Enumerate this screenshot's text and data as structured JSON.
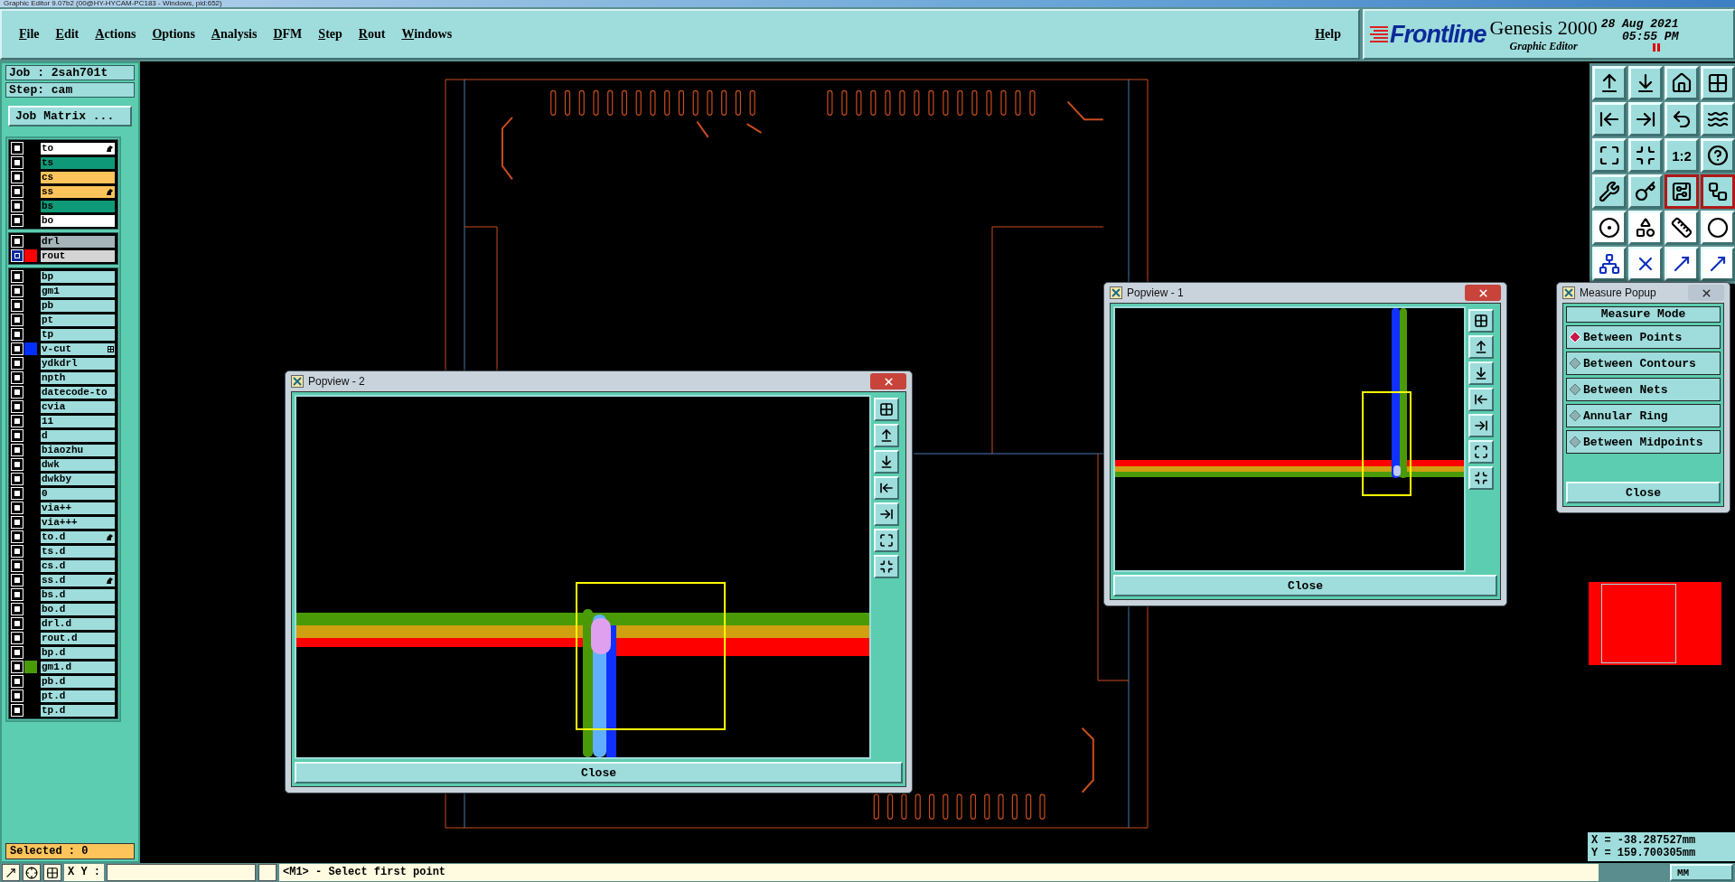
{
  "title_bar": {
    "title": "Graphic Editor 9.07b2 (00@HY-HYCAM-PC183 - Windows, pid:652)"
  },
  "menu": [
    "File",
    "Edit",
    "Actions",
    "Options",
    "Analysis",
    "DFM",
    "Step",
    "Rout",
    "Windows"
  ],
  "help": "Help",
  "brand": {
    "logo": "Frontline",
    "product": "Genesis 2000",
    "subtitle": "Graphic Editor",
    "date": "28 Aug 2021",
    "time": "05:55 PM"
  },
  "job": {
    "job": "Job : 2sah701t",
    "step": "Step: cam",
    "matrix_button": "Job Matrix ..."
  },
  "layer_groups": [
    {
      "layers": [
        {
          "name": "to",
          "color": "#ffffff",
          "selected": false,
          "badge": {
            "kind": "hand"
          }
        },
        {
          "name": "ts",
          "color": "#0e9a78",
          "selected": false
        },
        {
          "name": "cs",
          "color": "#fcc45a",
          "selected": false
        },
        {
          "name": "ss",
          "color": "#fcc45a",
          "selected": false,
          "badge": {
            "kind": "hand"
          }
        },
        {
          "name": "bs",
          "color": "#0e9a78",
          "selected": false
        },
        {
          "name": "bo",
          "color": "#ffffff",
          "selected": false
        }
      ]
    },
    {
      "layers": [
        {
          "name": "drl",
          "color": "#a4b4b8",
          "selected": false
        },
        {
          "name": "rout",
          "color": "#d4d4d4",
          "selected": true,
          "swatch": {
            "color": "#ff0000"
          }
        }
      ]
    },
    {
      "layers": [
        {
          "name": "bp",
          "color": "#9fdcdc",
          "selected": false
        },
        {
          "name": "gm1",
          "color": "#9fdcdc",
          "selected": false
        },
        {
          "name": "pb",
          "color": "#9fdcdc",
          "selected": false
        },
        {
          "name": "pt",
          "color": "#9fdcdc",
          "selected": false
        },
        {
          "name": "tp",
          "color": "#9fdcdc",
          "selected": false
        },
        {
          "name": "v-cut",
          "color": "#9fdcdc",
          "selected": false,
          "swatch": {
            "color": "#0030ff"
          },
          "badge": {
            "kind": "grid"
          }
        },
        {
          "name": "ydkdrl",
          "color": "#9fdcdc",
          "selected": false
        },
        {
          "name": "npth",
          "color": "#9fdcdc",
          "selected": false
        },
        {
          "name": "datecode-to",
          "color": "#9fdcdc",
          "selected": false
        },
        {
          "name": "cvia",
          "color": "#9fdcdc",
          "selected": false
        },
        {
          "name": "11",
          "color": "#9fdcdc",
          "selected": false
        },
        {
          "name": "d",
          "color": "#9fdcdc",
          "selected": false
        },
        {
          "name": "biaozhu",
          "color": "#9fdcdc",
          "selected": false
        },
        {
          "name": "dwk",
          "color": "#9fdcdc",
          "selected": false
        },
        {
          "name": "dwkby",
          "color": "#9fdcdc",
          "selected": false
        },
        {
          "name": "0",
          "color": "#9fdcdc",
          "selected": false
        },
        {
          "name": "via++",
          "color": "#9fdcdc",
          "selected": false
        },
        {
          "name": "via+++",
          "color": "#9fdcdc",
          "selected": false
        },
        {
          "name": "to.d",
          "color": "#9fdcdc",
          "selected": false,
          "badge": {
            "kind": "hand"
          }
        },
        {
          "name": "ts.d",
          "color": "#9fdcdc",
          "selected": false
        },
        {
          "name": "cs.d",
          "color": "#9fdcdc",
          "selected": false
        },
        {
          "name": "ss.d",
          "color": "#9fdcdc",
          "selected": false,
          "badge": {
            "kind": "hand"
          }
        },
        {
          "name": "bs.d",
          "color": "#9fdcdc",
          "selected": false
        },
        {
          "name": "bo.d",
          "color": "#9fdcdc",
          "selected": false
        },
        {
          "name": "drl.d",
          "color": "#9fdcdc",
          "selected": false
        },
        {
          "name": "rout.d",
          "color": "#9fdcdc",
          "selected": false
        },
        {
          "name": "bp.d",
          "color": "#9fdcdc",
          "selected": false
        },
        {
          "name": "gm1.d",
          "color": "#9fdcdc",
          "selected": false,
          "swatch": {
            "color": "#4a9a08"
          }
        },
        {
          "name": "pb.d",
          "color": "#9fdcdc",
          "selected": false
        },
        {
          "name": "pt.d",
          "color": "#9fdcdc",
          "selected": false
        },
        {
          "name": "tp.d",
          "color": "#9fdcdc",
          "selected": false
        }
      ]
    }
  ],
  "selected_count": "Selected : 0",
  "toolbar": [
    {
      "kind": "icon",
      "on": false
    },
    {
      "kind": "icon",
      "on": false
    },
    {
      "kind": "icon",
      "on": false
    },
    {
      "kind": "icon",
      "on": false
    },
    {
      "kind": "icon",
      "on": false
    },
    {
      "kind": "icon",
      "on": false
    },
    {
      "kind": "icon",
      "on": false
    },
    {
      "kind": "icon",
      "on": false
    },
    {
      "kind": "icon",
      "on": false
    },
    {
      "kind": "icon",
      "on": false
    },
    {
      "kind": "text",
      "label": "1:2",
      "on": false
    },
    {
      "kind": "icon",
      "on": false
    },
    {
      "kind": "icon",
      "on": false
    },
    {
      "kind": "icon",
      "on": false
    },
    {
      "kind": "icon",
      "on": true
    },
    {
      "kind": "icon",
      "on": true
    },
    {
      "kind": "icon",
      "on": false
    },
    {
      "kind": "icon",
      "on": false
    },
    {
      "kind": "icon",
      "on": false
    },
    {
      "kind": "icon",
      "on": false
    },
    {
      "kind": "icon",
      "on": false
    },
    {
      "kind": "icon",
      "on": false
    },
    {
      "kind": "icon",
      "on": false
    },
    {
      "kind": "icon",
      "on": false
    }
  ],
  "popviews": [
    {
      "title": "Popview - 2",
      "close": "Close"
    },
    {
      "title": "Popview - 1",
      "close": "Close"
    }
  ],
  "measure_popup": {
    "title": "Measure Popup",
    "heading": "Measure Mode",
    "options": [
      {
        "label": "Between Points",
        "selected": true
      },
      {
        "label": "Between Contours",
        "selected": false
      },
      {
        "label": "Between Nets",
        "selected": false
      },
      {
        "label": "Annular Ring",
        "selected": false
      },
      {
        "label": "Between Midpoints",
        "selected": false
      }
    ],
    "close": "Close"
  },
  "readout": {
    "x": "X = -38.287527mm",
    "y": "Y = 159.700305mm"
  },
  "status_bar": {
    "xy_label": "X Y :",
    "prompt": "<M1> - Select first point",
    "units": "MM"
  }
}
